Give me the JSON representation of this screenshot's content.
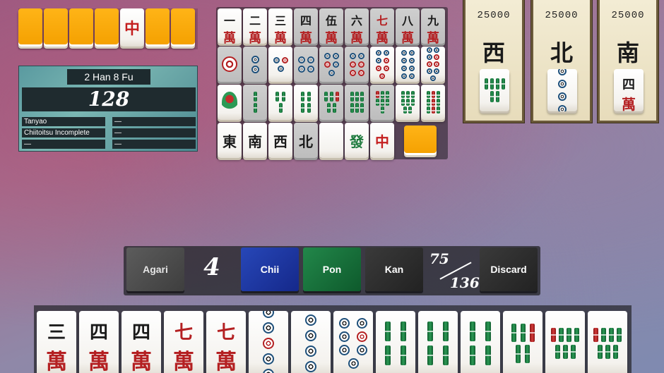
{
  "score_panel": {
    "title": "2 Han 8 Fu",
    "points": "128",
    "yaku": [
      {
        "name": "Tanyao",
        "value": "—"
      },
      {
        "name": "Chiitoitsu Incomplete",
        "value": "—"
      },
      {
        "name": "—",
        "value": "—"
      }
    ]
  },
  "wall": {
    "tiles": [
      "back",
      "back",
      "back",
      "back",
      "中",
      "back",
      "back"
    ]
  },
  "reference": {
    "man_numbers": [
      "一",
      "二",
      "三",
      "四",
      "伍",
      "六",
      "七",
      "八",
      "九"
    ],
    "man_suit": "萬",
    "honors": [
      "東",
      "南",
      "西",
      "北",
      "",
      "發",
      "中"
    ]
  },
  "opponents": [
    {
      "score": "25000",
      "wind": "西"
    },
    {
      "score": "25000",
      "wind": "北"
    },
    {
      "score": "25000",
      "wind": "南"
    }
  ],
  "opponent_discards": [
    {
      "type": "sou",
      "value": 6
    },
    {
      "type": "pin",
      "value": 4
    },
    {
      "type": "man",
      "value": "四"
    }
  ],
  "actions": {
    "agari": "Agari",
    "wait_count": "4",
    "chii": "Chii",
    "pon": "Pon",
    "kan": "Kan",
    "remaining": "75",
    "total": "136",
    "discard": "Discard"
  },
  "hand": [
    {
      "type": "man",
      "value": "三"
    },
    {
      "type": "man",
      "value": "四"
    },
    {
      "type": "man",
      "value": "四"
    },
    {
      "type": "man",
      "value": "七"
    },
    {
      "type": "man",
      "value": "七"
    },
    {
      "type": "pin",
      "value": 5
    },
    {
      "type": "pin",
      "value": 6
    },
    {
      "type": "pin",
      "value": 7
    },
    {
      "type": "sou",
      "value": 4
    },
    {
      "type": "sou",
      "value": 4
    },
    {
      "type": "sou",
      "value": 4
    },
    {
      "type": "sou",
      "value": 5
    },
    {
      "type": "sou",
      "value": 7
    },
    {
      "type": "sou",
      "value": 7
    }
  ]
}
